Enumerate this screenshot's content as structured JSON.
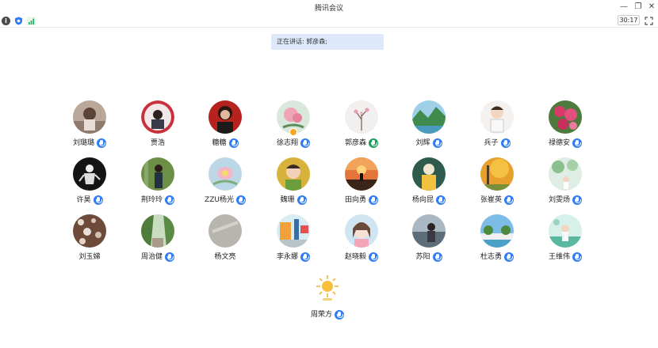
{
  "window": {
    "title": "腾讯会议"
  },
  "toolbar": {
    "timer": "30:17"
  },
  "speaking": {
    "text": "正在讲话: 郭彦森;"
  },
  "colors": {
    "accent": "#2f7cf6",
    "banner": "#dde9fb"
  },
  "participants": [
    {
      "name": "刘璐璐",
      "mic": true
    },
    {
      "name": "贾浩",
      "mic": false
    },
    {
      "name": "糖糖",
      "mic": true
    },
    {
      "name": "徐志翔",
      "mic": true
    },
    {
      "name": "郭彦森",
      "mic": true
    },
    {
      "name": "刘辉",
      "mic": true
    },
    {
      "name": "兵子",
      "mic": true
    },
    {
      "name": "禄德安",
      "mic": true
    },
    {
      "name": "许昊",
      "mic": true
    },
    {
      "name": "荆玲玲",
      "mic": true
    },
    {
      "name": "ZZU杨光",
      "mic": true
    },
    {
      "name": "魏珊",
      "mic": true
    },
    {
      "name": "田向勇",
      "mic": true
    },
    {
      "name": "杨向昆",
      "mic": true
    },
    {
      "name": "张崔英",
      "mic": true
    },
    {
      "name": "刘雯炀",
      "mic": true
    },
    {
      "name": "刘玉娣",
      "mic": false
    },
    {
      "name": "周治健",
      "mic": true
    },
    {
      "name": "杨文亮",
      "mic": false
    },
    {
      "name": "李永娜",
      "mic": true
    },
    {
      "name": "赵晓毅",
      "mic": true
    },
    {
      "name": "苏阳",
      "mic": true
    },
    {
      "name": "杜志勇",
      "mic": true
    },
    {
      "name": "王维伟",
      "mic": true
    },
    {
      "name": "周荣方",
      "mic": true
    }
  ]
}
